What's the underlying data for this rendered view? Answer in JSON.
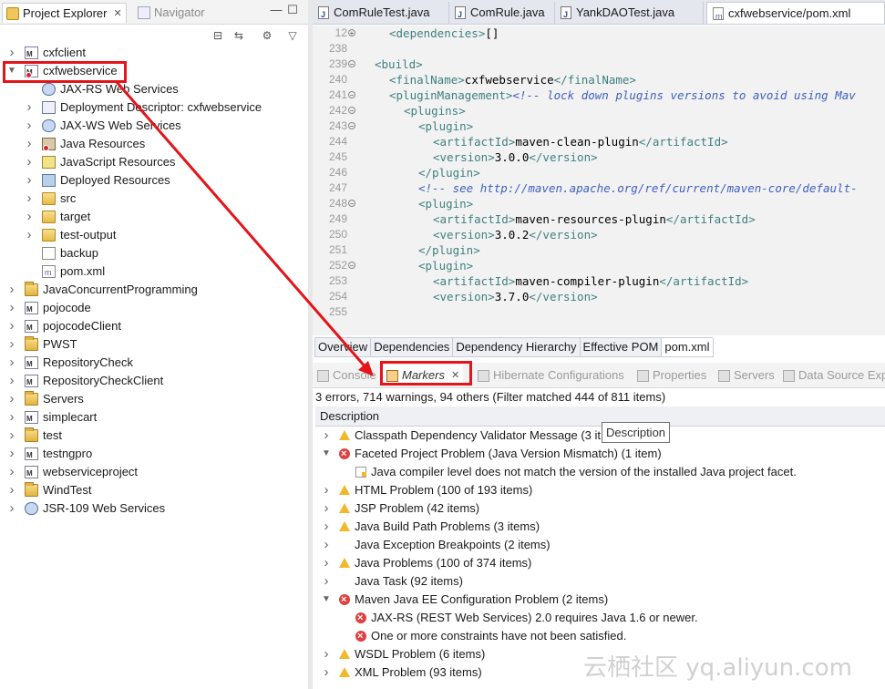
{
  "project_explorer": {
    "tabs": [
      {
        "label": "Project Explorer",
        "active": true
      },
      {
        "label": "Navigator",
        "active": false
      }
    ],
    "tree": [
      {
        "label": "cxfclient",
        "level": 0,
        "arrow": "right",
        "icon": "maven-project-icon"
      },
      {
        "label": "cxfwebservice",
        "level": 0,
        "arrow": "down",
        "icon": "maven-project-icon",
        "selected": true
      },
      {
        "label": "JAX-RS Web Services",
        "level": 1,
        "arrow": "",
        "icon": "web-services-icon"
      },
      {
        "label": "Deployment Descriptor: cxfwebservice",
        "level": 1,
        "arrow": "right",
        "icon": "deployment-descriptor-icon"
      },
      {
        "label": "JAX-WS Web Services",
        "level": 1,
        "arrow": "right",
        "icon": "web-services-icon"
      },
      {
        "label": "Java Resources",
        "level": 1,
        "arrow": "right",
        "icon": "java-resources-icon"
      },
      {
        "label": "JavaScript Resources",
        "level": 1,
        "arrow": "right",
        "icon": "javascript-resources-icon"
      },
      {
        "label": "Deployed Resources",
        "level": 1,
        "arrow": "right",
        "icon": "deployed-resources-icon"
      },
      {
        "label": "src",
        "level": 1,
        "arrow": "right",
        "icon": "folder-icon"
      },
      {
        "label": "target",
        "level": 1,
        "arrow": "right",
        "icon": "folder-icon"
      },
      {
        "label": "test-output",
        "level": 1,
        "arrow": "right",
        "icon": "folder-icon"
      },
      {
        "label": "backup",
        "level": 1,
        "arrow": "",
        "icon": "file-icon"
      },
      {
        "label": "pom.xml",
        "level": 1,
        "arrow": "",
        "icon": "pom-file-icon"
      },
      {
        "label": "JavaConcurrentProgramming",
        "level": 0,
        "arrow": "right",
        "icon": "project-folder-icon"
      },
      {
        "label": "pojocode",
        "level": 0,
        "arrow": "right",
        "icon": "maven-project-icon"
      },
      {
        "label": "pojocodeClient",
        "level": 0,
        "arrow": "right",
        "icon": "maven-project-icon"
      },
      {
        "label": "PWST",
        "level": 0,
        "arrow": "right",
        "icon": "project-folder-icon"
      },
      {
        "label": "RepositoryCheck",
        "level": 0,
        "arrow": "right",
        "icon": "maven-project-icon"
      },
      {
        "label": "RepositoryCheckClient",
        "level": 0,
        "arrow": "right",
        "icon": "maven-project-icon"
      },
      {
        "label": "Servers",
        "level": 0,
        "arrow": "right",
        "icon": "project-folder-icon"
      },
      {
        "label": "simplecart",
        "level": 0,
        "arrow": "right",
        "icon": "maven-project-icon"
      },
      {
        "label": "test",
        "level": 0,
        "arrow": "right",
        "icon": "project-folder-icon"
      },
      {
        "label": "testngpro",
        "level": 0,
        "arrow": "right",
        "icon": "maven-project-icon"
      },
      {
        "label": "webserviceproject",
        "level": 0,
        "arrow": "right",
        "icon": "maven-project-icon"
      },
      {
        "label": "WindTest",
        "level": 0,
        "arrow": "right",
        "icon": "project-folder-icon"
      },
      {
        "label": "JSR-109 Web Services",
        "level": 0,
        "arrow": "right",
        "icon": "web-services-icon"
      }
    ]
  },
  "editor": {
    "tabs": [
      {
        "label": "ComRuleTest.java",
        "active": false
      },
      {
        "label": "ComRule.java",
        "active": false
      },
      {
        "label": "YankDAOTest.java",
        "active": false
      },
      {
        "label": "cxfwebservice/pom.xml",
        "active": true
      }
    ],
    "lines": [
      {
        "no": "12",
        "fold": "+",
        "indent": 1,
        "parts": [
          [
            "tag",
            "<dependencies>"
          ],
          [
            "val",
            "[]"
          ]
        ]
      },
      {
        "no": "238",
        "fold": "",
        "indent": 0,
        "parts": []
      },
      {
        "no": "239",
        "fold": "-",
        "indent": 0,
        "parts": [
          [
            "tag",
            "<build>"
          ]
        ]
      },
      {
        "no": "240",
        "fold": "",
        "indent": 1,
        "parts": [
          [
            "tag",
            "<finalName>"
          ],
          [
            "val",
            "cxfwebservice"
          ],
          [
            "tag",
            "</finalName>"
          ]
        ]
      },
      {
        "no": "241",
        "fold": "-",
        "indent": 1,
        "parts": [
          [
            "tag",
            "<pluginManagement>"
          ],
          [
            "com",
            "<!-- lock down plugins versions to avoid using Mav"
          ]
        ]
      },
      {
        "no": "242",
        "fold": "-",
        "indent": 2,
        "parts": [
          [
            "tag",
            "<plugins>"
          ]
        ]
      },
      {
        "no": "243",
        "fold": "-",
        "indent": 3,
        "parts": [
          [
            "tag",
            "<plugin>"
          ]
        ]
      },
      {
        "no": "244",
        "fold": "",
        "indent": 4,
        "parts": [
          [
            "tag",
            "<artifactId>"
          ],
          [
            "val",
            "maven-clean-plugin"
          ],
          [
            "tag",
            "</artifactId>"
          ]
        ]
      },
      {
        "no": "245",
        "fold": "",
        "indent": 4,
        "parts": [
          [
            "tag",
            "<version>"
          ],
          [
            "val",
            "3.0.0"
          ],
          [
            "tag",
            "</version>"
          ]
        ]
      },
      {
        "no": "246",
        "fold": "",
        "indent": 3,
        "parts": [
          [
            "tag",
            "</plugin>"
          ]
        ]
      },
      {
        "no": "247",
        "fold": "",
        "indent": 3,
        "parts": [
          [
            "com",
            "<!-- see http://maven.apache.org/ref/current/maven-core/default-"
          ]
        ]
      },
      {
        "no": "248",
        "fold": "-",
        "indent": 3,
        "parts": [
          [
            "tag",
            "<plugin>"
          ]
        ]
      },
      {
        "no": "249",
        "fold": "",
        "indent": 4,
        "parts": [
          [
            "tag",
            "<artifactId>"
          ],
          [
            "val",
            "maven-resources-plugin"
          ],
          [
            "tag",
            "</artifactId>"
          ]
        ]
      },
      {
        "no": "250",
        "fold": "",
        "indent": 4,
        "parts": [
          [
            "tag",
            "<version>"
          ],
          [
            "val",
            "3.0.2"
          ],
          [
            "tag",
            "</version>"
          ]
        ]
      },
      {
        "no": "251",
        "fold": "",
        "indent": 3,
        "parts": [
          [
            "tag",
            "</plugin>"
          ]
        ]
      },
      {
        "no": "252",
        "fold": "-",
        "indent": 3,
        "parts": [
          [
            "tag",
            "<plugin>"
          ]
        ]
      },
      {
        "no": "253",
        "fold": "",
        "indent": 4,
        "parts": [
          [
            "tag",
            "<artifactId>"
          ],
          [
            "val",
            "maven-compiler-plugin"
          ],
          [
            "tag",
            "</artifactId>"
          ]
        ]
      },
      {
        "no": "254",
        "fold": "",
        "indent": 4,
        "parts": [
          [
            "tag",
            "<version>"
          ],
          [
            "val",
            "3.7.0"
          ],
          [
            "tag",
            "</version>"
          ]
        ]
      },
      {
        "no": "255",
        "fold": "",
        "indent": 0,
        "parts": []
      }
    ],
    "pom_tabs": [
      {
        "label": "Overview",
        "active": false
      },
      {
        "label": "Dependencies",
        "active": false
      },
      {
        "label": "Dependency Hierarchy",
        "active": false
      },
      {
        "label": "Effective POM",
        "active": false
      },
      {
        "label": "pom.xml",
        "active": true
      }
    ]
  },
  "markers_view": {
    "tabs": [
      {
        "label": "Console",
        "active": false
      },
      {
        "label": "Markers",
        "active": true
      },
      {
        "label": "Hibernate Configurations",
        "active": false
      },
      {
        "label": "Properties",
        "active": false
      },
      {
        "label": "Servers",
        "active": false
      },
      {
        "label": "Data Source Exp",
        "active": false
      }
    ],
    "summary": "3 errors, 714 warnings, 94 others (Filter matched 444 of 811 items)",
    "column_header": "Description",
    "tooltip": "Description",
    "rows": [
      {
        "label": "Classpath Dependency Validator Message (3 it",
        "level": 0,
        "arrow": "right",
        "icon": "warning"
      },
      {
        "label": "Faceted Project Problem (Java Version Mismatch) (1 item)",
        "level": 0,
        "arrow": "down",
        "icon": "error"
      },
      {
        "label": "Java compiler level does not match the version of the installed Java project facet.",
        "level": 1,
        "arrow": "",
        "icon": "facet"
      },
      {
        "label": "HTML Problem (100 of 193 items)",
        "level": 0,
        "arrow": "right",
        "icon": "warning"
      },
      {
        "label": "JSP Problem (42 items)",
        "level": 0,
        "arrow": "right",
        "icon": "warning"
      },
      {
        "label": "Java Build Path Problems (3 items)",
        "level": 0,
        "arrow": "right",
        "icon": "warning"
      },
      {
        "label": "Java Exception Breakpoints (2 items)",
        "level": 0,
        "arrow": "right",
        "icon": ""
      },
      {
        "label": "Java Problems (100 of 374 items)",
        "level": 0,
        "arrow": "right",
        "icon": "warning"
      },
      {
        "label": "Java Task (92 items)",
        "level": 0,
        "arrow": "right",
        "icon": ""
      },
      {
        "label": "Maven Java EE Configuration Problem (2 items)",
        "level": 0,
        "arrow": "down",
        "icon": "error"
      },
      {
        "label": "JAX-RS (REST Web Services) 2.0 requires Java 1.6 or newer.",
        "level": 1,
        "arrow": "",
        "icon": "error"
      },
      {
        "label": "One or more constraints have not been satisfied.",
        "level": 1,
        "arrow": "",
        "icon": "error"
      },
      {
        "label": "WSDL Problem (6 items)",
        "level": 0,
        "arrow": "right",
        "icon": "warning"
      },
      {
        "label": "XML Problem (93 items)",
        "level": 0,
        "arrow": "right",
        "icon": "warning"
      }
    ]
  },
  "watermark": "云栖社区 yq.aliyun.com",
  "colors": {
    "annotation": "#e3141a",
    "error": "#e04040",
    "warning": "#f0b82a"
  }
}
